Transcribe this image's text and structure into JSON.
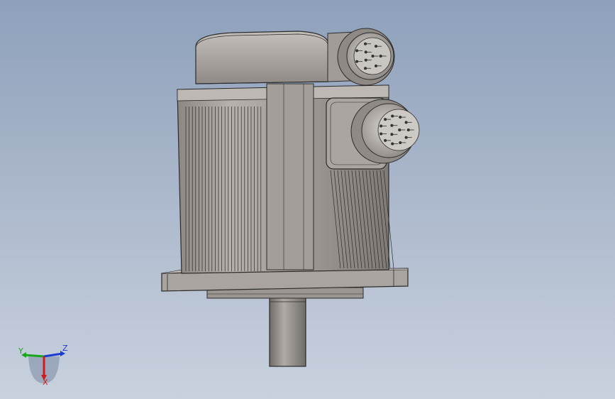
{
  "viewport": {
    "background_top": "#8ea0bb",
    "background_bottom": "#c9d1de"
  },
  "model": {
    "description_icon": "servo-motor-model",
    "body_color": "#a8a39e",
    "edge_color": "#2b2b2b",
    "shaft_color": "#8f8a85",
    "connectors": [
      {
        "name": "top-connector",
        "pins": 10
      },
      {
        "name": "front-connector",
        "pins": 14
      }
    ]
  },
  "triad": {
    "x_label": "X",
    "y_label": "Y",
    "z_label": "Z",
    "x_color": "#d11a1a",
    "y_color": "#1aa51a",
    "z_color": "#1a3ad1"
  }
}
